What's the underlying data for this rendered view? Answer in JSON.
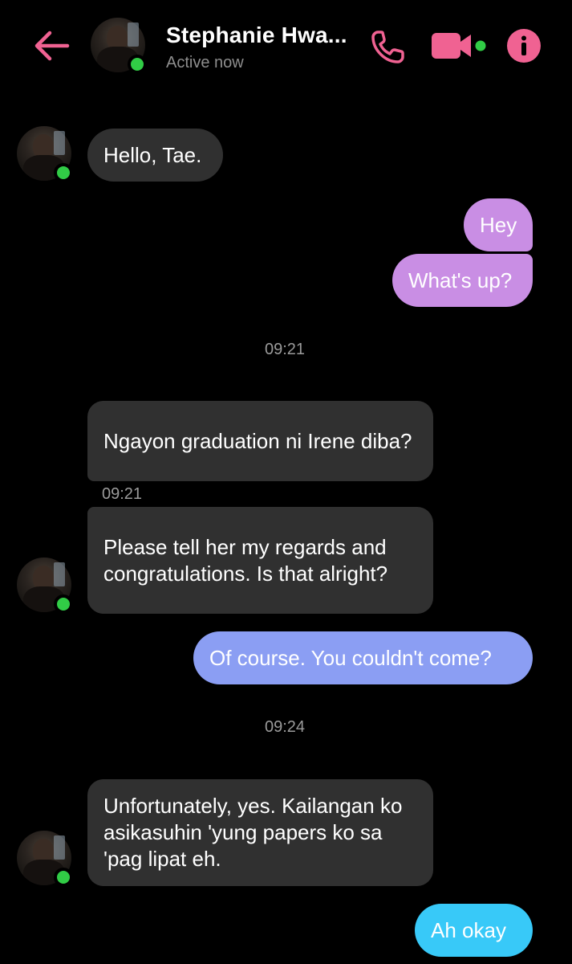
{
  "header": {
    "contact_name": "Stephanie Hwa...",
    "status": "Active now",
    "icons": [
      "back-arrow-icon",
      "phone-icon",
      "video-camera-icon",
      "info-icon"
    ],
    "accent_color": "#f06292"
  },
  "messages": [
    {
      "side": "incoming",
      "text": "Hello, Tae."
    },
    {
      "side": "outgoing",
      "text": "Hey"
    },
    {
      "side": "outgoing",
      "text": "What's up?"
    },
    {
      "type": "timestamp",
      "text": "09:21"
    },
    {
      "side": "incoming",
      "text": "Ngayon graduation ni Irene diba?"
    },
    {
      "type": "timestamp",
      "text": "09:21"
    },
    {
      "side": "incoming",
      "text": "Please tell her my regards and congratulations. Is that alright?"
    },
    {
      "side": "outgoing",
      "text": "Of course. You couldn't come?"
    },
    {
      "type": "timestamp",
      "text": "09:24"
    },
    {
      "side": "incoming",
      "text": "Unfortunately, yes. Kailangan ko asikasuhin 'yung papers ko sa 'pag lipat eh."
    },
    {
      "side": "outgoing",
      "text": "Ah okay"
    }
  ]
}
